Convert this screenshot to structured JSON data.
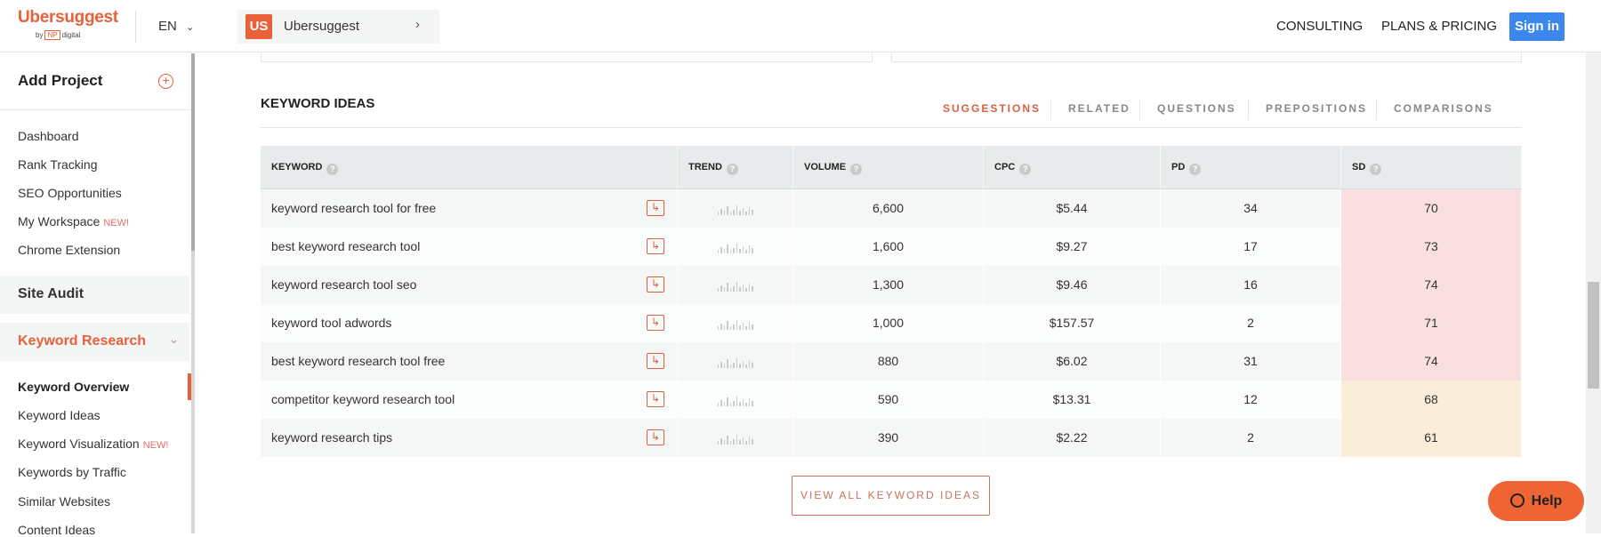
{
  "header": {
    "logo": "Ubersuggest",
    "logo_by": "by",
    "logo_np": "NP",
    "logo_digital": "digital",
    "language": "EN",
    "breadcrumb_badge": "US",
    "breadcrumb_name": "Ubersuggest",
    "nav": [
      "CONSULTING",
      "PLANS & PRICING"
    ],
    "signin": "Sign in"
  },
  "sidebar": {
    "add_project": "Add Project",
    "items": [
      "Dashboard",
      "Rank Tracking",
      "SEO Opportunities",
      "My Workspace",
      "Chrome Extension"
    ],
    "new_badge": "NEW!",
    "site_audit": "Site Audit",
    "keyword_research": "Keyword Research",
    "sub_items": [
      "Keyword Overview",
      "Keyword Ideas",
      "Keyword Visualization",
      "Keywords by Traffic",
      "Similar Websites",
      "Content Ideas"
    ]
  },
  "main": {
    "title": "KEYWORD IDEAS",
    "tabs": [
      "SUGGESTIONS",
      "RELATED",
      "QUESTIONS",
      "PREPOSITIONS",
      "COMPARISONS"
    ],
    "active_tab": "SUGGESTIONS",
    "columns": [
      "KEYWORD",
      "TREND",
      "VOLUME",
      "CPC",
      "PD",
      "SD"
    ],
    "rows": [
      {
        "keyword": "keyword research tool for free",
        "volume": "6,600",
        "cpc": "$5.44",
        "pd": "34",
        "sd": "70"
      },
      {
        "keyword": "best keyword research tool",
        "volume": "1,600",
        "cpc": "$9.27",
        "pd": "17",
        "sd": "73"
      },
      {
        "keyword": "keyword research tool seo",
        "volume": "1,300",
        "cpc": "$9.46",
        "pd": "16",
        "sd": "74"
      },
      {
        "keyword": "keyword tool adwords",
        "volume": "1,000",
        "cpc": "$157.57",
        "pd": "2",
        "sd": "71"
      },
      {
        "keyword": "best keyword research tool free",
        "volume": "880",
        "cpc": "$6.02",
        "pd": "31",
        "sd": "74"
      },
      {
        "keyword": "competitor keyword research tool",
        "volume": "590",
        "cpc": "$13.31",
        "pd": "12",
        "sd": "68"
      },
      {
        "keyword": "keyword research tips",
        "volume": "390",
        "cpc": "$2.22",
        "pd": "2",
        "sd": "61"
      }
    ],
    "view_all": "VIEW ALL KEYWORD IDEAS"
  },
  "help": "Help",
  "colors": {
    "accent": "#e8613a",
    "signin": "#3c87ee",
    "sd_high": "#fadfe0",
    "sd_mid": "#faeedb"
  }
}
